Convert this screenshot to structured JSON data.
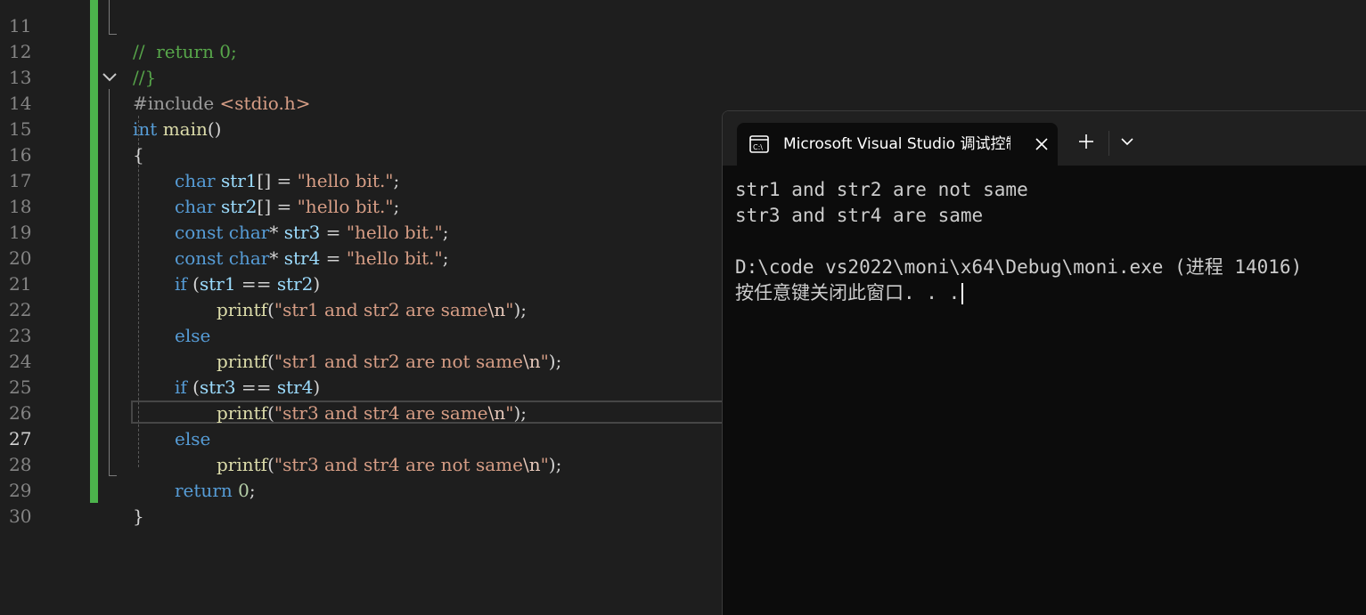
{
  "editor": {
    "lines": [
      {
        "num": "11",
        "text": "//  return 0;"
      },
      {
        "num": "12",
        "text": "//}"
      },
      {
        "num": "13",
        "directive": "#include",
        "header": "<stdio.h>"
      },
      {
        "num": "14",
        "type": "int",
        "name": "main",
        "paren": "()"
      },
      {
        "num": "15",
        "text": "{"
      },
      {
        "num": "16",
        "type": "char",
        "var": "str1",
        "decl": "[] = ",
        "str": "\"hello bit.\"",
        "end": ";"
      },
      {
        "num": "17",
        "type": "char",
        "var": "str2",
        "decl": "[] = ",
        "str": "\"hello bit.\"",
        "end": ";"
      },
      {
        "num": "18",
        "qual": "const",
        "type": "char",
        "ptr": "* ",
        "var": "str3",
        "decl": " = ",
        "str": "\"hello bit.\"",
        "end": ";"
      },
      {
        "num": "19",
        "qual": "const",
        "type": "char",
        "ptr": "* ",
        "var": "str4",
        "decl": " = ",
        "str": "\"hello bit.\"",
        "end": ";"
      },
      {
        "num": "20",
        "kw": "if",
        "open": " (",
        "a": "str1",
        "op": " == ",
        "b": "str2",
        "close": ")"
      },
      {
        "num": "21",
        "fn": "printf",
        "open": "(",
        "str": "\"str1 and str2 are same",
        "esc": "\\n",
        "q": "\"",
        "close": ");"
      },
      {
        "num": "22",
        "kw": "else"
      },
      {
        "num": "23",
        "fn": "printf",
        "open": "(",
        "str": "\"str1 and str2 are not same",
        "esc": "\\n",
        "q": "\"",
        "close": ");"
      },
      {
        "num": "24",
        "kw": "if",
        "open": " (",
        "a": "str3",
        "op": " == ",
        "b": "str4",
        "close": ")"
      },
      {
        "num": "25",
        "fn": "printf",
        "open": "(",
        "str": "\"str3 and str4 are same",
        "esc": "\\n",
        "q": "\"",
        "close": ");"
      },
      {
        "num": "26",
        "kw": "else"
      },
      {
        "num": "27",
        "fn": "printf",
        "open": "(",
        "str": "\"str3 and str4 are not same",
        "esc": "\\n",
        "q": "\"",
        "close": ");"
      },
      {
        "num": "28",
        "kw": "return",
        "space": " ",
        "val": "0",
        "end": ";"
      },
      {
        "num": "29",
        "text": "}"
      },
      {
        "num": "30",
        "text": ""
      }
    ]
  },
  "terminal": {
    "tab_title": "Microsoft Visual Studio 调试控制台",
    "tab_icon": "console-icon",
    "close_icon": "close-icon",
    "new_tab_icon": "plus-icon",
    "dropdown_icon": "chevron-down-icon",
    "output": [
      "str1 and str2 are not same",
      "str3 and str4 are same",
      "",
      "D:\\code vs2022\\moni\\x64\\Debug\\moni.exe (进程 14016)",
      "按任意键关闭此窗口. . ."
    ]
  },
  "colors": {
    "keyword": "#569cd6",
    "identifier": "#9cdcfe",
    "function": "#dcdcaa",
    "string": "#d69d85",
    "number": "#b5cea8",
    "comment": "#57a64a",
    "change_bar": "#4cb34c"
  }
}
